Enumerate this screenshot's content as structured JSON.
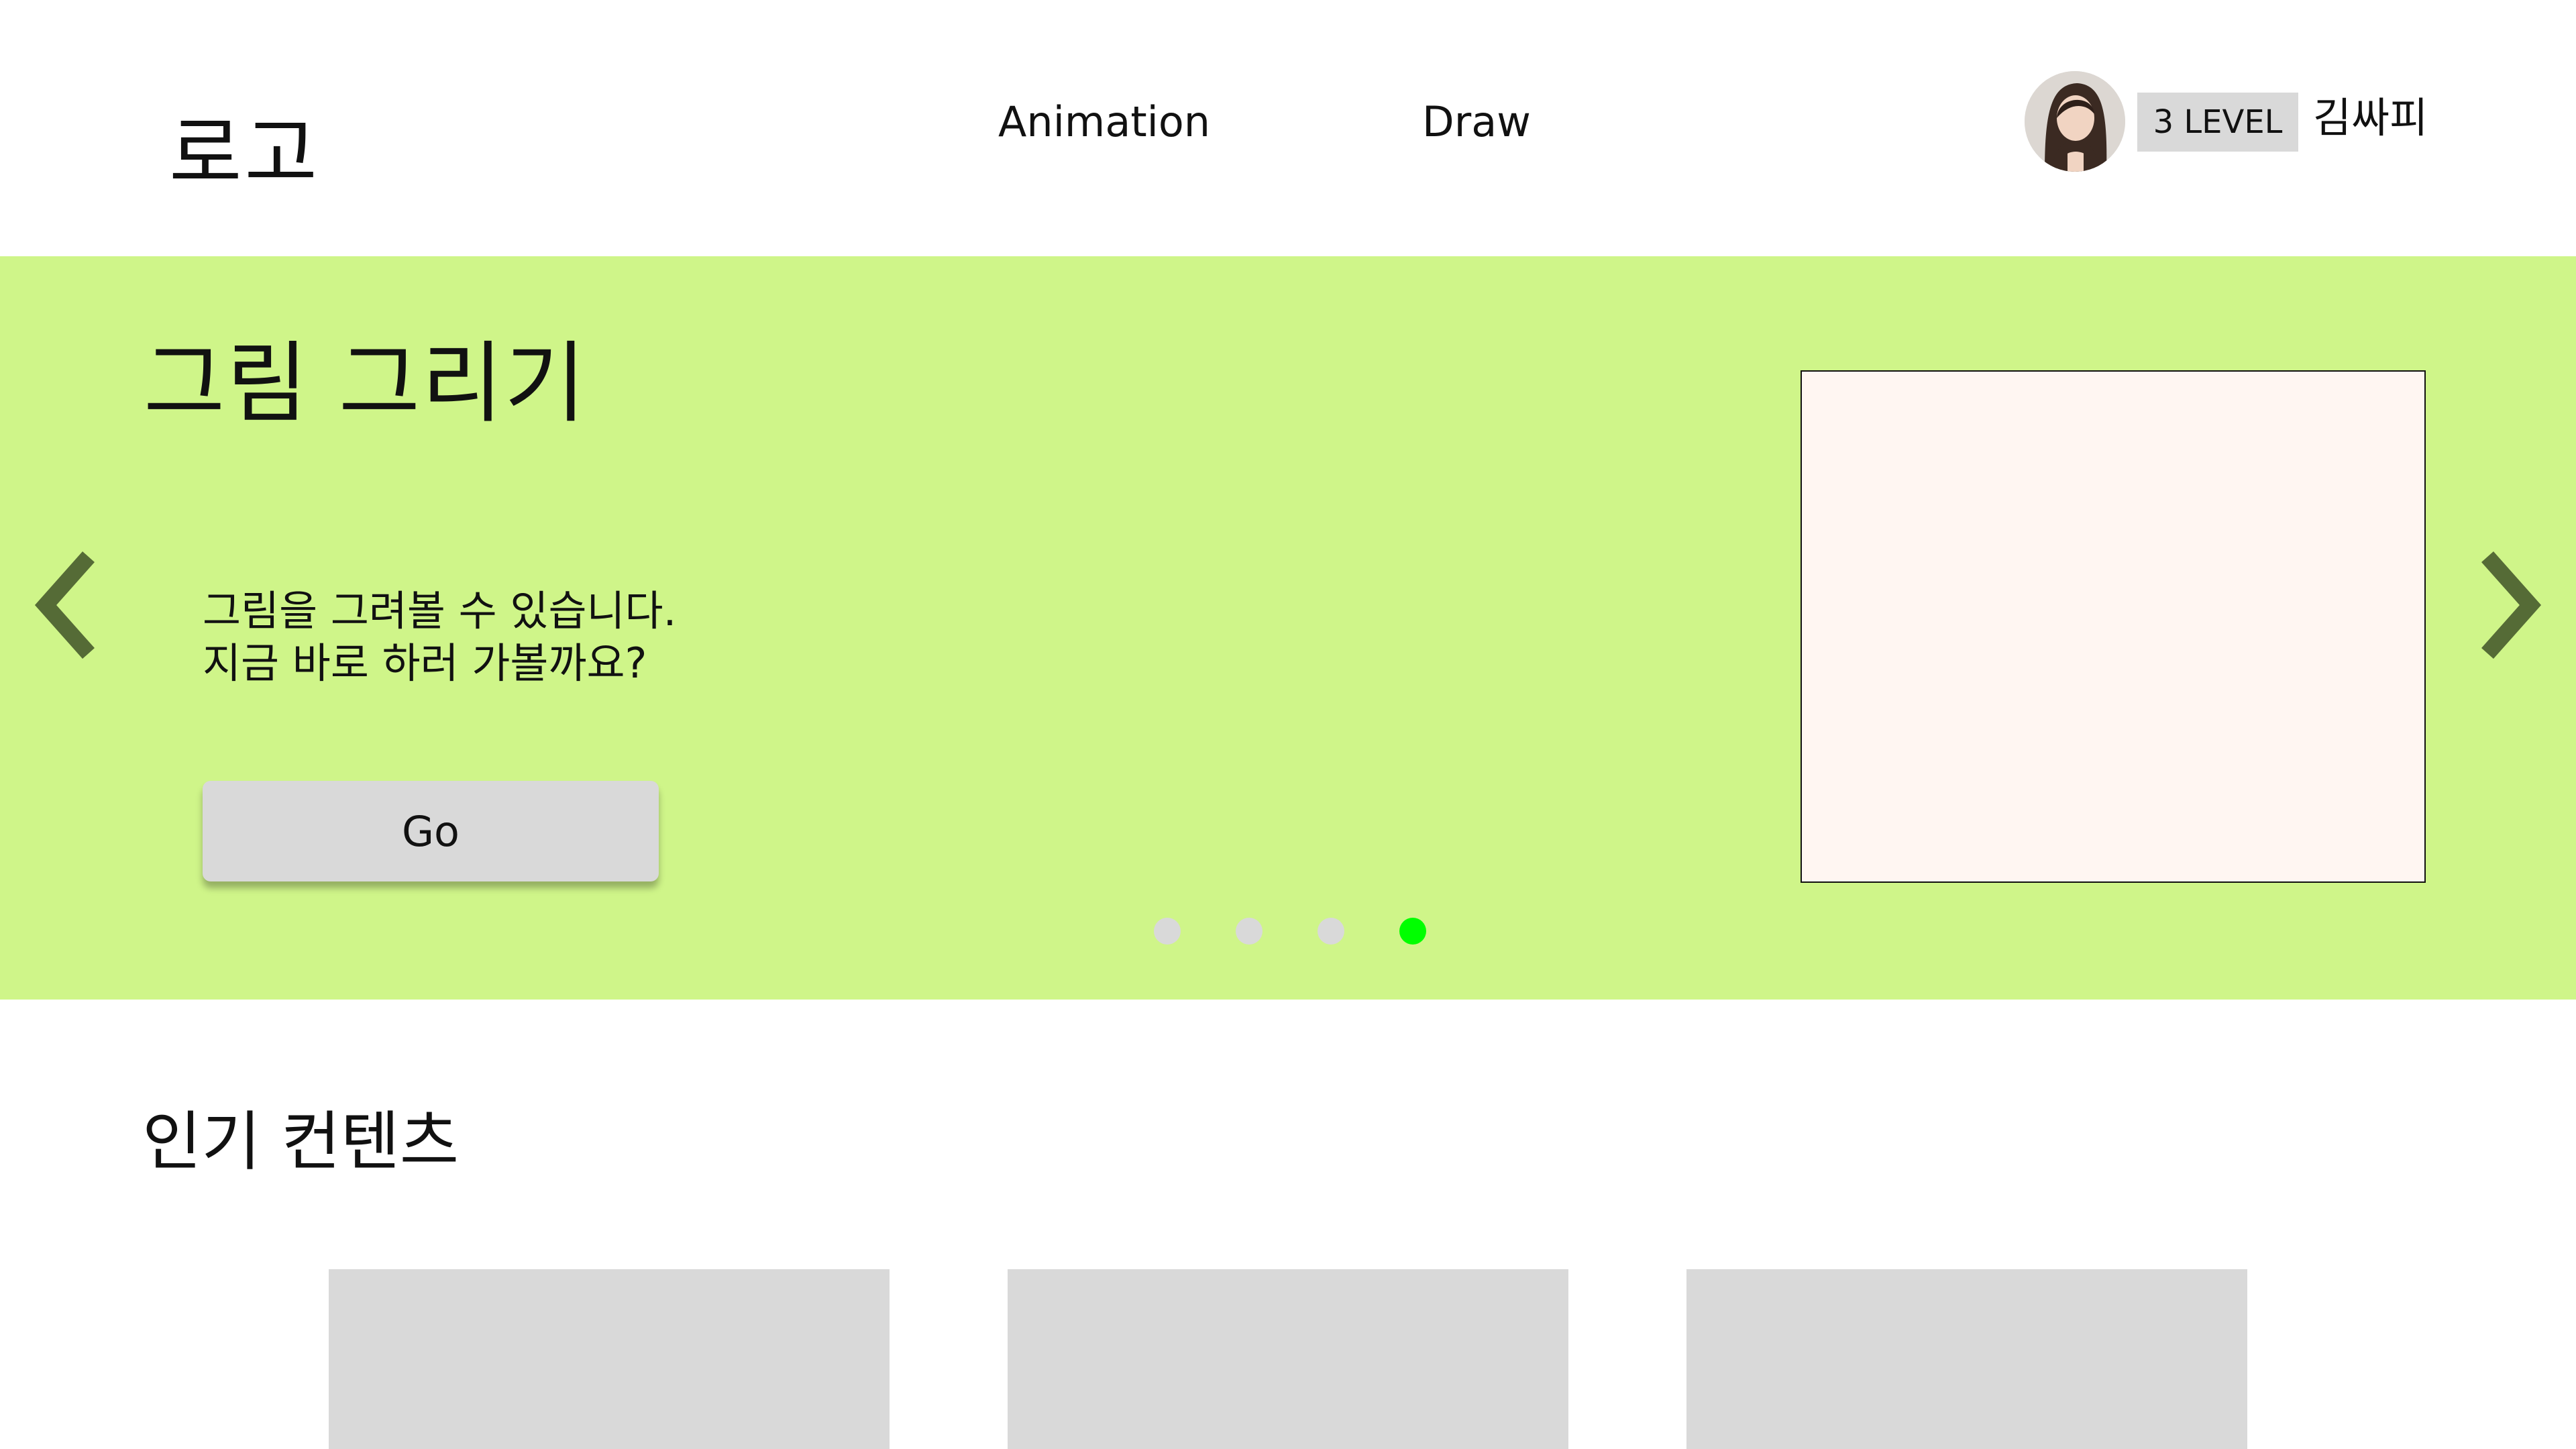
{
  "header": {
    "logo": "로고",
    "nav": [
      {
        "label": "Animation"
      },
      {
        "label": "Draw"
      }
    ],
    "user": {
      "level": "3 LEVEL",
      "name": "김싸피"
    }
  },
  "hero": {
    "title": "그림 그리기",
    "description_lines": [
      "그림을 그려볼 수 있습니다.",
      "지금 바로 하러 가볼까요?"
    ],
    "button_label": "Go",
    "carousel": {
      "total": 4,
      "active_index": 4
    },
    "icons": {
      "prev": "chevron-left-icon",
      "next": "chevron-right-icon"
    }
  },
  "popular": {
    "title": "인기 컨텐츠",
    "card_count": 3
  },
  "colors": {
    "hero_bg": "#cff589",
    "arrow": "#556b36",
    "dot_active": "#00ff00",
    "dot_inactive": "#d9d9d9",
    "image_placeholder": "#fff6f2",
    "card_placeholder": "#d9d9d9",
    "badge_bg": "#d9d9d9"
  }
}
